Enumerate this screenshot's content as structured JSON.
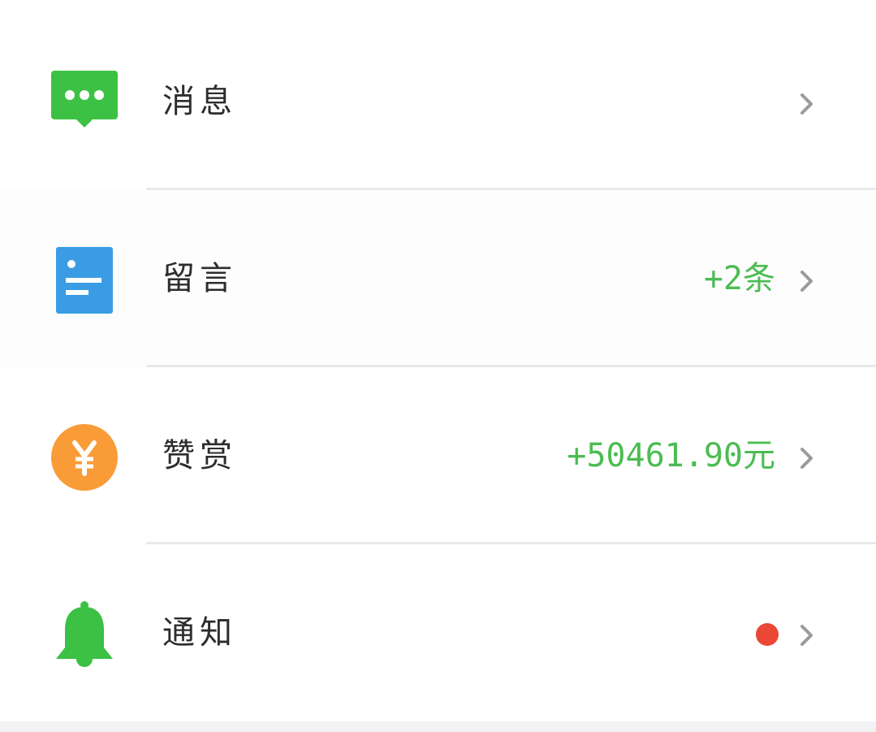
{
  "menu": {
    "items": [
      {
        "label": "消息",
        "value": "",
        "icon": "chat-bubble-icon",
        "icon_color": "#3cc144"
      },
      {
        "label": "留言",
        "value": "+2条",
        "icon": "document-icon",
        "icon_color": "#3a9ce4"
      },
      {
        "label": "赞赏",
        "value": "+50461.90元",
        "icon": "yen-coin-icon",
        "icon_color": "#f99c37"
      },
      {
        "label": "通知",
        "value": "",
        "icon": "bell-icon",
        "icon_color": "#3cc144",
        "badge": "red-dot"
      }
    ]
  },
  "colors": {
    "value_text": "#4cbc52",
    "label_text": "#2d2d2d",
    "chevron": "#9b9b9b",
    "badge_dot": "#ea4736",
    "divider": "#e9e9ec"
  }
}
